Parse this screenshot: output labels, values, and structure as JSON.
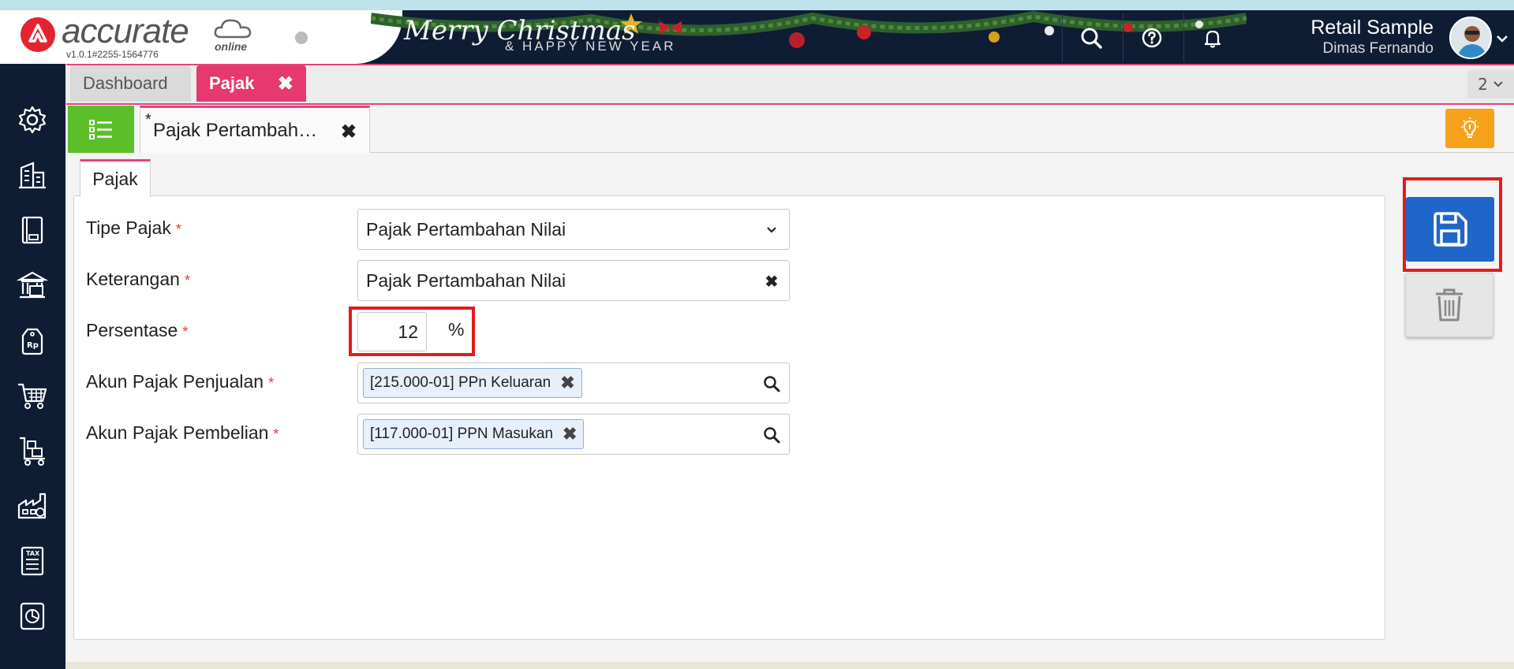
{
  "app": {
    "brand": "accurate",
    "brand_suffix": "online",
    "version": "v1.0.1#2255-1564776",
    "banner_title": "Merry Christmas",
    "banner_subtitle": "& HAPPY NEW YEAR",
    "company": "Retail Sample",
    "user": "Dimas Fernando"
  },
  "module_tabs": [
    {
      "label": "Dashboard",
      "active": false
    },
    {
      "label": "Pajak",
      "active": true
    }
  ],
  "tab_counter": "2",
  "document_tab": {
    "label": "Pajak Pertambah…",
    "modified_marker": "*"
  },
  "form_tab": "Pajak",
  "form": {
    "tipe_pajak": {
      "label": "Tipe Pajak",
      "value": "Pajak Pertambahan Nilai"
    },
    "keterangan": {
      "label": "Keterangan",
      "value": "Pajak Pertambahan Nilai"
    },
    "persentase": {
      "label": "Persentase",
      "value": "12",
      "unit": "%"
    },
    "akun_penjualan": {
      "label": "Akun Pajak Penjualan",
      "value": "[215.000-01] PPn Keluaran"
    },
    "akun_pembelian": {
      "label": "Akun Pajak Pembelian",
      "value": "[117.000-01] PPN Masukan"
    },
    "required_marker": "*"
  },
  "colors": {
    "header_bg": "#0f1d34",
    "accent_pink": "#e5396f",
    "list_green": "#5cbf2a",
    "save_blue": "#1f66c9",
    "tip_orange": "#f7a21b",
    "highlight_red": "#e31b1b"
  },
  "sidebar_icons": [
    "gear-icon",
    "building-icon",
    "book-icon",
    "bank-icon",
    "price-tag-icon",
    "cart-icon",
    "trolley-icon",
    "factory-icon",
    "tax-icon",
    "report-icon"
  ]
}
